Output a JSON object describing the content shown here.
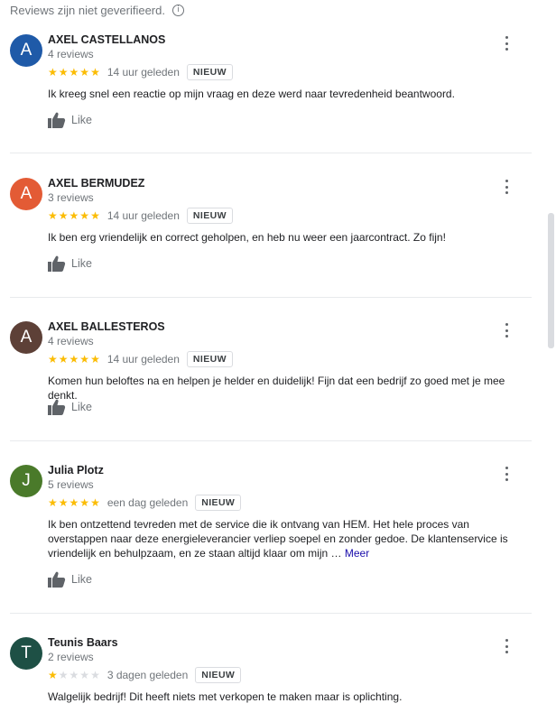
{
  "notice": {
    "text": "Reviews zijn niet geverifieerd.",
    "icon": "info-icon"
  },
  "like_label": "Like",
  "more_label": "Meer",
  "reviews": [
    {
      "name": "AXEL CASTELLANOS",
      "initial": "A",
      "avatar_color": "#1f5aa8",
      "review_count": "4 reviews",
      "rating": 5,
      "time": "14 uur geleden",
      "badge": "NIEUW",
      "text": "Ik kreeg snel een reactie op mijn vraag en deze werd naar tevredenheid beantwoord."
    },
    {
      "name": "AXEL BERMUDEZ",
      "initial": "A",
      "avatar_color": "#e35b35",
      "review_count": "3 reviews",
      "rating": 5,
      "time": "14 uur geleden",
      "badge": "NIEUW",
      "text": "Ik ben erg vriendelijk en correct geholpen, en heb nu weer een jaarcontract. Zo fijn!"
    },
    {
      "name": "AXEL BALLESTEROS",
      "initial": "A",
      "avatar_color": "#5d4037",
      "review_count": "4 reviews",
      "rating": 5,
      "time": "14 uur geleden",
      "badge": "NIEUW",
      "text": "Komen hun beloftes na en helpen je helder en duidelijk! Fijn dat een bedrijf zo goed met je mee denkt."
    },
    {
      "name": "Julia Plotz",
      "initial": "J",
      "avatar_color": "#4a7a2a",
      "review_count": "5 reviews",
      "rating": 5,
      "time": "een dag geleden",
      "badge": "NIEUW",
      "text": "Ik ben ontzettend tevreden met de service die ik ontvang van HEM. Het hele proces van overstappen naar deze energieleverancier verliep soepel en zonder gedoe. De klantenservice is vriendelijk en behulpzaam, en ze staan altijd klaar om mijn …"
    },
    {
      "name": "Teunis Baars",
      "initial": "T",
      "avatar_color": "#1e5045",
      "review_count": "2 reviews",
      "rating": 1,
      "time": "3 dagen geleden",
      "badge": "NIEUW",
      "text": "Walgelijk bedrijf! Dit heeft niets met verkopen te maken maar is oplichting."
    }
  ]
}
